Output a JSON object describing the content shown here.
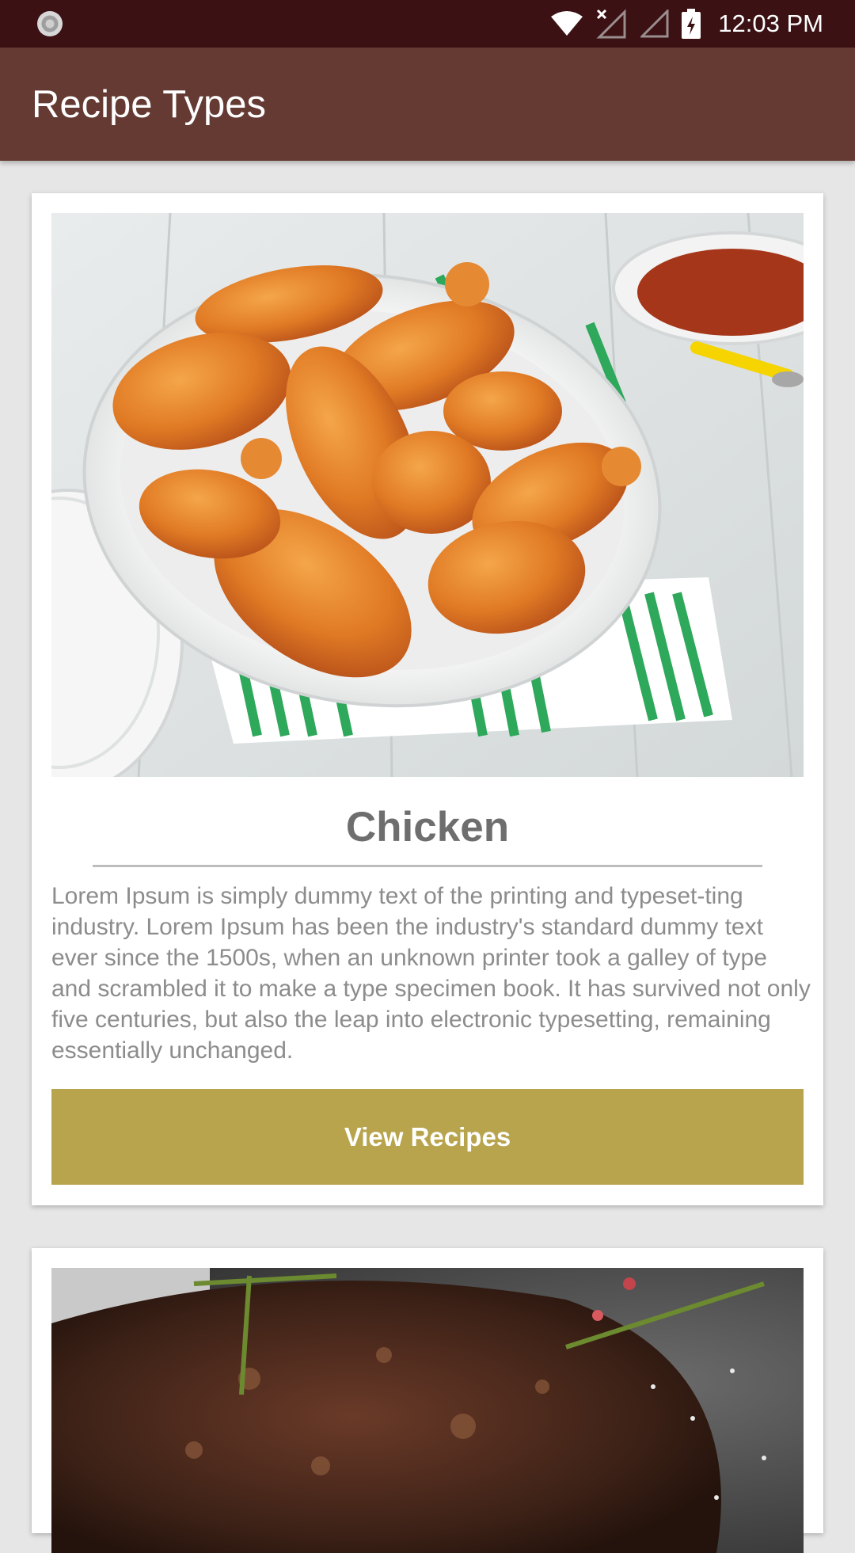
{
  "status_bar": {
    "time": "12:03 PM",
    "icons": [
      "notification-icon",
      "wifi-icon",
      "signal-x-icon",
      "signal-icon",
      "battery-charging-icon"
    ]
  },
  "app_bar": {
    "title": "Recipe Types"
  },
  "cards": [
    {
      "image": "grilled-chicken-photo",
      "title": "Chicken",
      "description": "Lorem Ipsum is simply dummy text of the printing and typeset-ting industry. Lorem Ipsum has been the industry's standard dummy text ever since the 1500s, when an unknown printer took a galley of type and scrambled it to make a type specimen book. It has survived not only five centuries, but also the leap into electronic typesetting, remaining essentially unchanged.",
      "button_label": "View Recipes"
    },
    {
      "image": "grilled-steak-photo"
    }
  ],
  "colors": {
    "status_bar": "#3b1114",
    "app_bar": "#643a33",
    "button": "#b7a44d",
    "background": "#e6e6e6"
  }
}
